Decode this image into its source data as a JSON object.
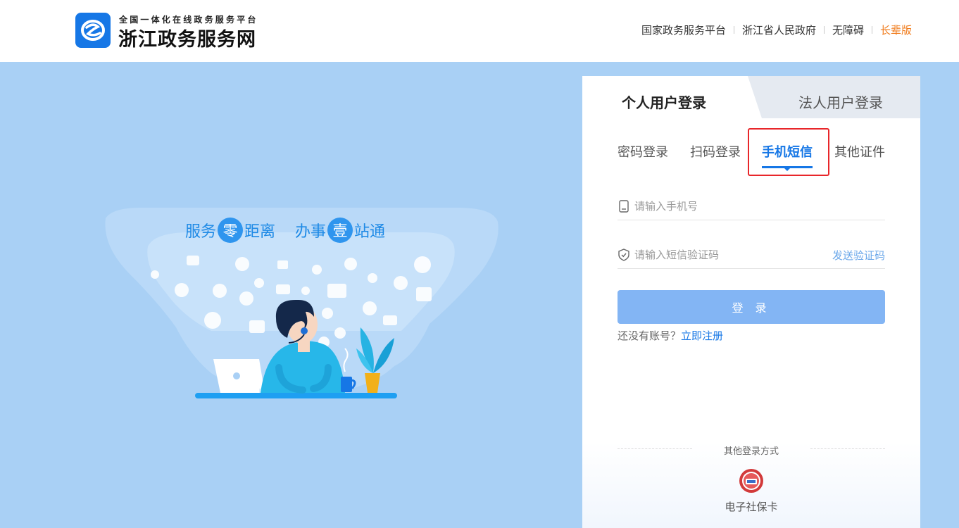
{
  "header": {
    "brand_sub": "全国一体化在线政务服务平台",
    "brand_main": "浙江政务服务网",
    "links": [
      "国家政务服务平台",
      "浙江省人民政府",
      "无障碍",
      "长辈版"
    ]
  },
  "hero": {
    "slogan_a1": "服务",
    "slogan_a2": "零",
    "slogan_a3": "距离",
    "slogan_b1": "办事",
    "slogan_b2": "壹",
    "slogan_b3": "站通"
  },
  "login": {
    "user_tabs": [
      "个人用户登录",
      "法人用户登录"
    ],
    "method_tabs": [
      "密码登录",
      "扫码登录",
      "手机短信",
      "其他证件"
    ],
    "active_method": "手机短信",
    "phone_placeholder": "请输入手机号",
    "code_placeholder": "请输入短信验证码",
    "send_code": "发送验证码",
    "submit": "登 录",
    "no_account": "还没有账号？",
    "register": "立即注册",
    "other_title": "其他登录方式",
    "ecard_label": "电子社保卡"
  },
  "colors": {
    "accent": "#1677e6",
    "background": "#a9d0f5",
    "button": "#83b5f4",
    "elder_link": "#f07b1b",
    "highlight": "#e8262a"
  }
}
